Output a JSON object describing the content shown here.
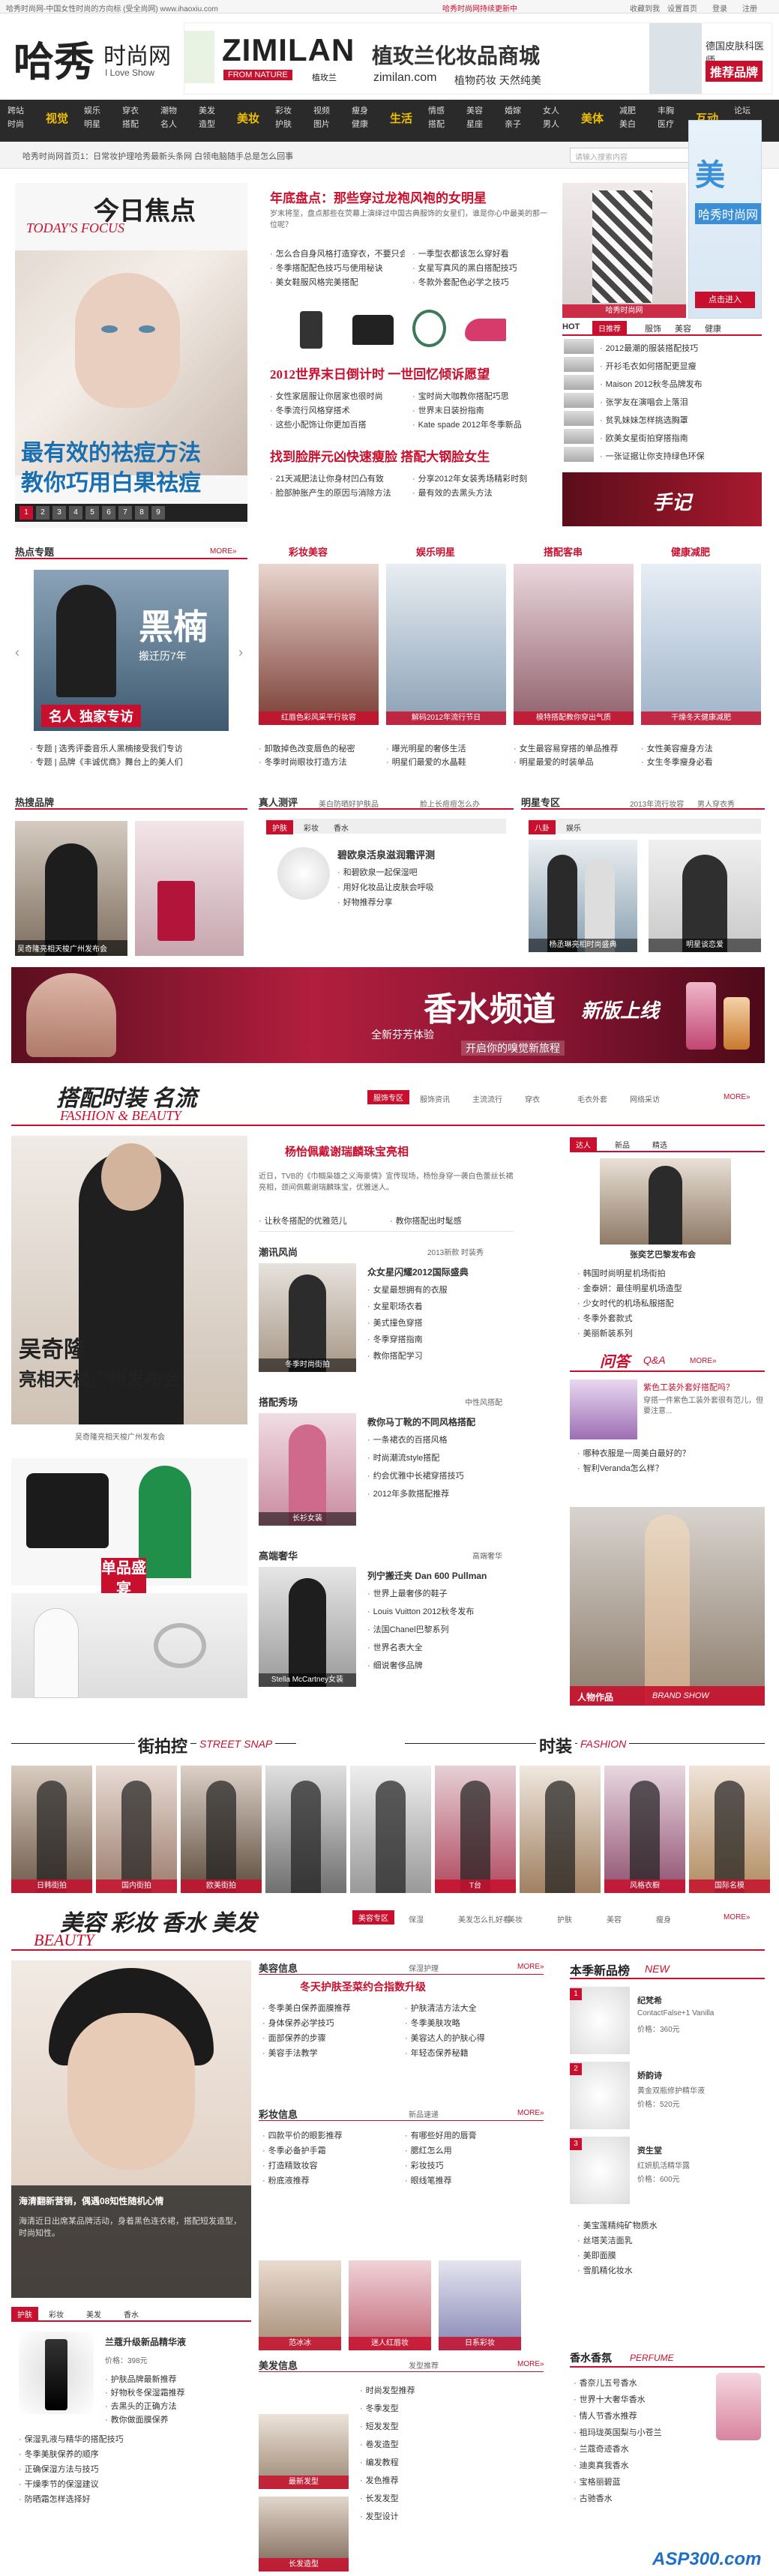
{
  "topbar": {
    "left": "哈秀时尚网-中国女性时尚的方向标 (受全尚网) www.ihaoxiu.com",
    "mid": "哈秀时尚网持续更新中",
    "links": [
      "收藏到我",
      "设置首页",
      "登录",
      "注册"
    ]
  },
  "logo": {
    "cn": "哈秀",
    "sub": "时尚网",
    "en": "I Love Show"
  },
  "ad_top": {
    "brand": "ZIMILAN",
    "tag": "FROM NATURE",
    "cn": "植玫兰",
    "title": "植玫兰化妆品商城",
    "url": "zimilan.com",
    "slogan": "植物药妆 天然纯美",
    "right1": "德国皮肤科医师",
    "right2": "推荐品牌"
  },
  "nav": {
    "cols": [
      [
        "跨站",
        "时尚"
      ],
      [
        "视觉"
      ],
      [
        "娱乐",
        "明星"
      ],
      [
        "穿衣",
        "搭配"
      ],
      [
        "潮物",
        "名人"
      ],
      [
        "美发",
        "造型"
      ],
      [
        "美妆"
      ],
      [
        "彩妆",
        "护肤"
      ],
      [
        "视频",
        "图片"
      ],
      [
        "瘦身",
        "健康"
      ],
      [
        "生活"
      ],
      [
        "情感",
        "搭配"
      ],
      [
        "美容",
        "星座"
      ],
      [
        "婚嫁",
        "亲子"
      ],
      [
        "女人",
        "男人"
      ],
      [
        "美体"
      ],
      [
        "减肥",
        "美白"
      ],
      [
        "丰胸",
        "医疗"
      ],
      [
        "互动"
      ],
      [
        "论坛",
        "博客"
      ]
    ]
  },
  "breadcrumb": "哈秀时尚网首页1：日常妆护理哈秀最新头条网 白领电脑随手总是怎么回事",
  "search_ph": "请输入搜索内容",
  "focus": {
    "title_cn": "今日焦点",
    "title_en": "TODAY'S FOCUS",
    "overlay1": "最有效的祛痘方法",
    "overlay2": "教你巧用白果祛痘",
    "pages": [
      "1",
      "2",
      "3",
      "4",
      "5",
      "6",
      "7",
      "8",
      "9"
    ]
  },
  "headline1": {
    "title": "年底盘点：那些穿过龙袍风袍的女明星",
    "desc": "岁末将至，盘点那些在荧幕上演绎过中国古典服饰的女星们，谁是你心中最美的那一位呢？",
    "items": [
      "怎么合自身风格打造穿衣，不要只会随大流",
      "一季型衣都该怎么穿好看",
      "冬季搭配配色技巧与使用秘诀",
      "女星写真风的黑白搭配技巧",
      "美女鞋服风格完美搭配",
      "冬款外套配色必学之技巧"
    ]
  },
  "headline2": {
    "title": "2012世界末日倒计时 一世回忆倾诉愿望",
    "items": [
      "女性家居服让你居家也很时尚",
      "宝时尚大咖教你搭配巧思",
      "冬季流行风格穿搭术",
      "世界末日装扮指南",
      "这些小配饰让你更加百搭",
      "Kate spade 2012年冬季新品"
    ]
  },
  "headline3": {
    "title": "找到脸胖元凶快速瘦脸 搭配大钢脸女生",
    "items": [
      "21天减肥法让你身材凹凸有致",
      "分享2012年女装秀场精彩时刻",
      "脸部肿胀产生的原因与消除方法",
      "最有效的去黑头方法"
    ]
  },
  "sidebar_top": {
    "tab1": "HOT",
    "tab2": "日推荐",
    "tab3": "服饰",
    "tab4": "美容",
    "tab5": "健康",
    "items": [
      "2012最潮的服装搭配技巧",
      "开衫毛衣如何搭配更显瘦",
      "Maison 2012秋冬品牌发布",
      "张学友在演唱会上落泪",
      "贫乳妹妹怎样挑选胸罩",
      "欧美女星街拍穿搭指南",
      "一张证据让你支持绿色环保"
    ],
    "btn": "点击进入",
    "label": "哈秀时尚网"
  },
  "hotzt": {
    "title": "热点专题",
    "more": "MORE»",
    "img_text": "黑楠",
    "img_sub": "搬迁历7年",
    "img_badge": "名人  独家专访",
    "items": [
      "专题 | 选秀评委音乐人黑楠接受我们专访",
      "专题 | 品牌《丰诚优商》舞台上的美人们"
    ]
  },
  "four": [
    {
      "title": "彩妆美容",
      "cap": "红唇色彩风采平行妆容",
      "items": [
        "卸散掉色改变唇色的秘密",
        "冬季时尚眼妆打造方法"
      ]
    },
    {
      "title": "娱乐明星",
      "cap": "解码2012年流行节日",
      "items": [
        "曝光明星的奢侈生活",
        "明星们最爱的水晶鞋"
      ]
    },
    {
      "title": "搭配客串",
      "cap": "模特搭配教你穿出气质",
      "items": [
        "女生最容易穿搭的单品推荐",
        "明星最爱的时装单品"
      ]
    },
    {
      "title": "健康减肥",
      "cap": "干燥冬天健康减肥",
      "items": [
        "女性美容瘦身方法",
        "女生冬季瘦身必看"
      ]
    }
  ],
  "hotpp": {
    "title": "热搜品牌",
    "cap": "吴奇隆亮相天梭广州发布会"
  },
  "tryout": {
    "title": "真人测评",
    "subs": [
      "美白防晒好护肤品",
      "脸上长痘痘怎么办"
    ],
    "tabs": [
      "护肤",
      "彩妆",
      "香水"
    ],
    "headline": "碧欧泉活泉滋润霜评测",
    "items": [
      "和碧欧泉一起保湿吧",
      "用好化妆品让皮肤会呼吸",
      "好物推荐分享"
    ]
  },
  "stars": {
    "title": "明星专区",
    "subs": [
      "2013年流行妆容",
      "男人穿衣秀"
    ],
    "tabs": [
      "八卦",
      "娱乐"
    ],
    "caps": [
      "杨丞琳亮相时尚盛典",
      "明星谈恋爱"
    ]
  },
  "banner_perfume": {
    "title": "香水频道",
    "new": "新版上线",
    "sub1": "全新芬芳体验",
    "sub2": "开启你的嗅觉新旅程"
  },
  "fashion": {
    "title_cn": "搭配时装 名流",
    "title_en": "FASHION & BEAUTY",
    "tab_on": "服饰专区",
    "tabs": [
      "服饰资讯",
      "主流流行",
      "穿衣",
      "毛衣外套",
      "网络采访"
    ],
    "more": "MORE»",
    "big_cap1": "吴奇隆",
    "big_cap2": "亮相天梭广州发布会",
    "big_small": "吴奇隆亮相天梭广州发布会",
    "headline": "杨怡佩戴谢瑞麟珠宝亮相",
    "lead": "近日，TVB的《巾帼枭雄之义海豪情》宣传现场，杨怡身穿一袭白色蕾丝长裙亮相，颈间佩戴谢瑞麟珠宝，优雅迷人。",
    "leftitems": [
      "让秋冬搭配的优雅范儿",
      "教你搭配出时髦感"
    ],
    "sec1": {
      "title": "潮讯风尚",
      "tag": "2013新款 时装秀",
      "head": "众女星闪耀2012国际盛典",
      "items": [
        "女星最想拥有的衣服",
        "女星职场衣着",
        "美式撞色穿搭",
        "冬季穿搭指南",
        "教你搭配学习"
      ]
    },
    "sec2": {
      "title": "搭配秀场",
      "tag": "中性风搭配",
      "head": "教你马丁靴的不同风格搭配",
      "items": [
        "一条裙衣的百搭风格",
        "时尚潮流style搭配",
        "约会优雅中长裙穿搭技巧",
        "2012年多款搭配推荐"
      ]
    },
    "sec3": {
      "title": "高端奢华",
      "tag": "高端奢华",
      "head": "列宁搬迁夹 Dan 600 Pullman",
      "items": [
        "世界上最奢侈的鞋子",
        "Louis Vuitton 2012秋冬发布",
        "法国Chanel巴黎系列",
        "世界名表大全",
        "细说奢侈品牌"
      ]
    },
    "caps": [
      "冬季时尚街拍",
      "长衫女装",
      "单品盛宴",
      "Stella McCartney女装"
    ]
  },
  "rside1": {
    "tab1": "达人",
    "tab2": "新品",
    "tab3": "精选",
    "cap": "张奕艺巴黎发布会",
    "items": [
      "韩国时尚明星机场街拍",
      "金泰妍：最佳明星机场造型",
      "少女时代的机场私服搭配",
      "冬季外套款式",
      "美丽新装系列"
    ]
  },
  "qa": {
    "title": "问答",
    "title_en": "Q&A",
    "more": "MORE»",
    "q1": "紫色工装外套好搭配吗？",
    "a1": "穿搭一件紫色工装外套很有范儿，但要注意...",
    "items": [
      "哪种衣服是一周美白最好的？",
      "智利Veranda怎么样？"
    ]
  },
  "rside2": {
    "cap": "人物作品",
    "cap_en": "BRAND SHOW"
  },
  "streetsnap": {
    "title_cn": "街拍控",
    "title_en": "STREET SNAP",
    "title2_cn": "时装",
    "title2_en": "FASHION",
    "caps": [
      "日韩街拍",
      "国内街拍",
      "欧美街拍",
      "",
      "",
      "T台",
      "",
      "风格衣橱",
      "国际名模"
    ]
  },
  "beauty": {
    "title_cn": "美容 彩妆 香水 美发",
    "title_en": "BEAUTY",
    "tab_on": "美容专区",
    "tabs": [
      "保湿",
      "美发怎么扎好看",
      "美妆",
      "护肤",
      "美容",
      "瘦身"
    ],
    "more": "MORE»",
    "feature_cap": "海清翻新营销，偶遇08知性随机心情",
    "feature_desc": "海清近日出席某品牌活动，身着黑色连衣裙，搭配短发造型，时尚知性。",
    "tabs_small": [
      "护肤",
      "彩妆",
      "美发",
      "香水"
    ],
    "prod_title": "兰蔻升级新品精华液",
    "prod_price": "价格：398元",
    "prod_items": [
      "护肤品牌最新推荐",
      "好物秋冬保湿霜推荐",
      "去黑头的正确方法",
      "教你做面膜保养"
    ],
    "left_items": [
      "保湿乳液与精华的搭配技巧",
      "冬季美肤保养的顺序",
      "正确保湿方法与技巧",
      "干燥季节的保湿建议",
      "防晒霜怎样选择好"
    ]
  },
  "beauty_mid": {
    "sec1": {
      "title": "美容信息",
      "tag": "保湿护理",
      "more": "MORE»",
      "head": "冬天护肤圣菜约合指数升级",
      "items": [
        "冬季美白保养面膜推荐",
        "护肤清洁方法大全",
        "身体保养必学技巧",
        "冬季美肤攻略",
        "面部保养的步骤",
        "美容达人的护肤心得",
        "美容手法教学",
        "年轻态保养秘籍"
      ]
    },
    "sec2": {
      "title": "彩妆信息",
      "tag": "新品速递",
      "more": "MORE»",
      "items": [
        "四款平价的眼影推荐",
        "有哪些好用的唇膏",
        "冬季必备护手霜",
        "腮红怎么用",
        "打造精致妆容",
        "彩妆技巧",
        "粉底液推荐",
        "眼线笔推荐"
      ],
      "caps": [
        "范冰冰",
        "迷人红唇妆",
        "日系彩妆"
      ]
    },
    "sec3": {
      "title": "美发信息",
      "tag": "发型推荐",
      "more": "MORE»",
      "items": [
        "时尚发型推荐",
        "冬季发型",
        "短发发型",
        "卷发造型",
        "编发教程",
        "发色推荐",
        "长发发型",
        "发型设计"
      ],
      "caps": [
        "最新发型",
        "长发造型"
      ]
    }
  },
  "rside3": {
    "title": "本季新品榜",
    "title_en": "NEW",
    "items": [
      {
        "name": "纪梵希",
        "sub": "ContactFalse+1 Vanilla",
        "sub2": "价格：360元"
      },
      {
        "name": "娇韵诗",
        "sub": "黄金双瓶修护精华液",
        "sub2": "价格：520元"
      },
      {
        "name": "资生堂",
        "sub": "红妍肌活精华露",
        "sub2": "价格：600元"
      }
    ],
    "list": [
      "美宝莲精纯矿物质水",
      "丝塔芙洁面乳",
      "美即面膜",
      "雪肌精化妆水"
    ]
  },
  "perfume": {
    "title": "香水香氛",
    "title_en": "PERFUME",
    "items": [
      "香奈儿五号香水",
      "世界十大奢华香水",
      "情人节香水推荐",
      "祖玛珑英国梨与小苍兰",
      "兰蔻奇迹香水",
      "迪奥真我香水",
      "宝格丽碧蓝",
      "古驰香水"
    ]
  },
  "watermark": "ASP300.com"
}
